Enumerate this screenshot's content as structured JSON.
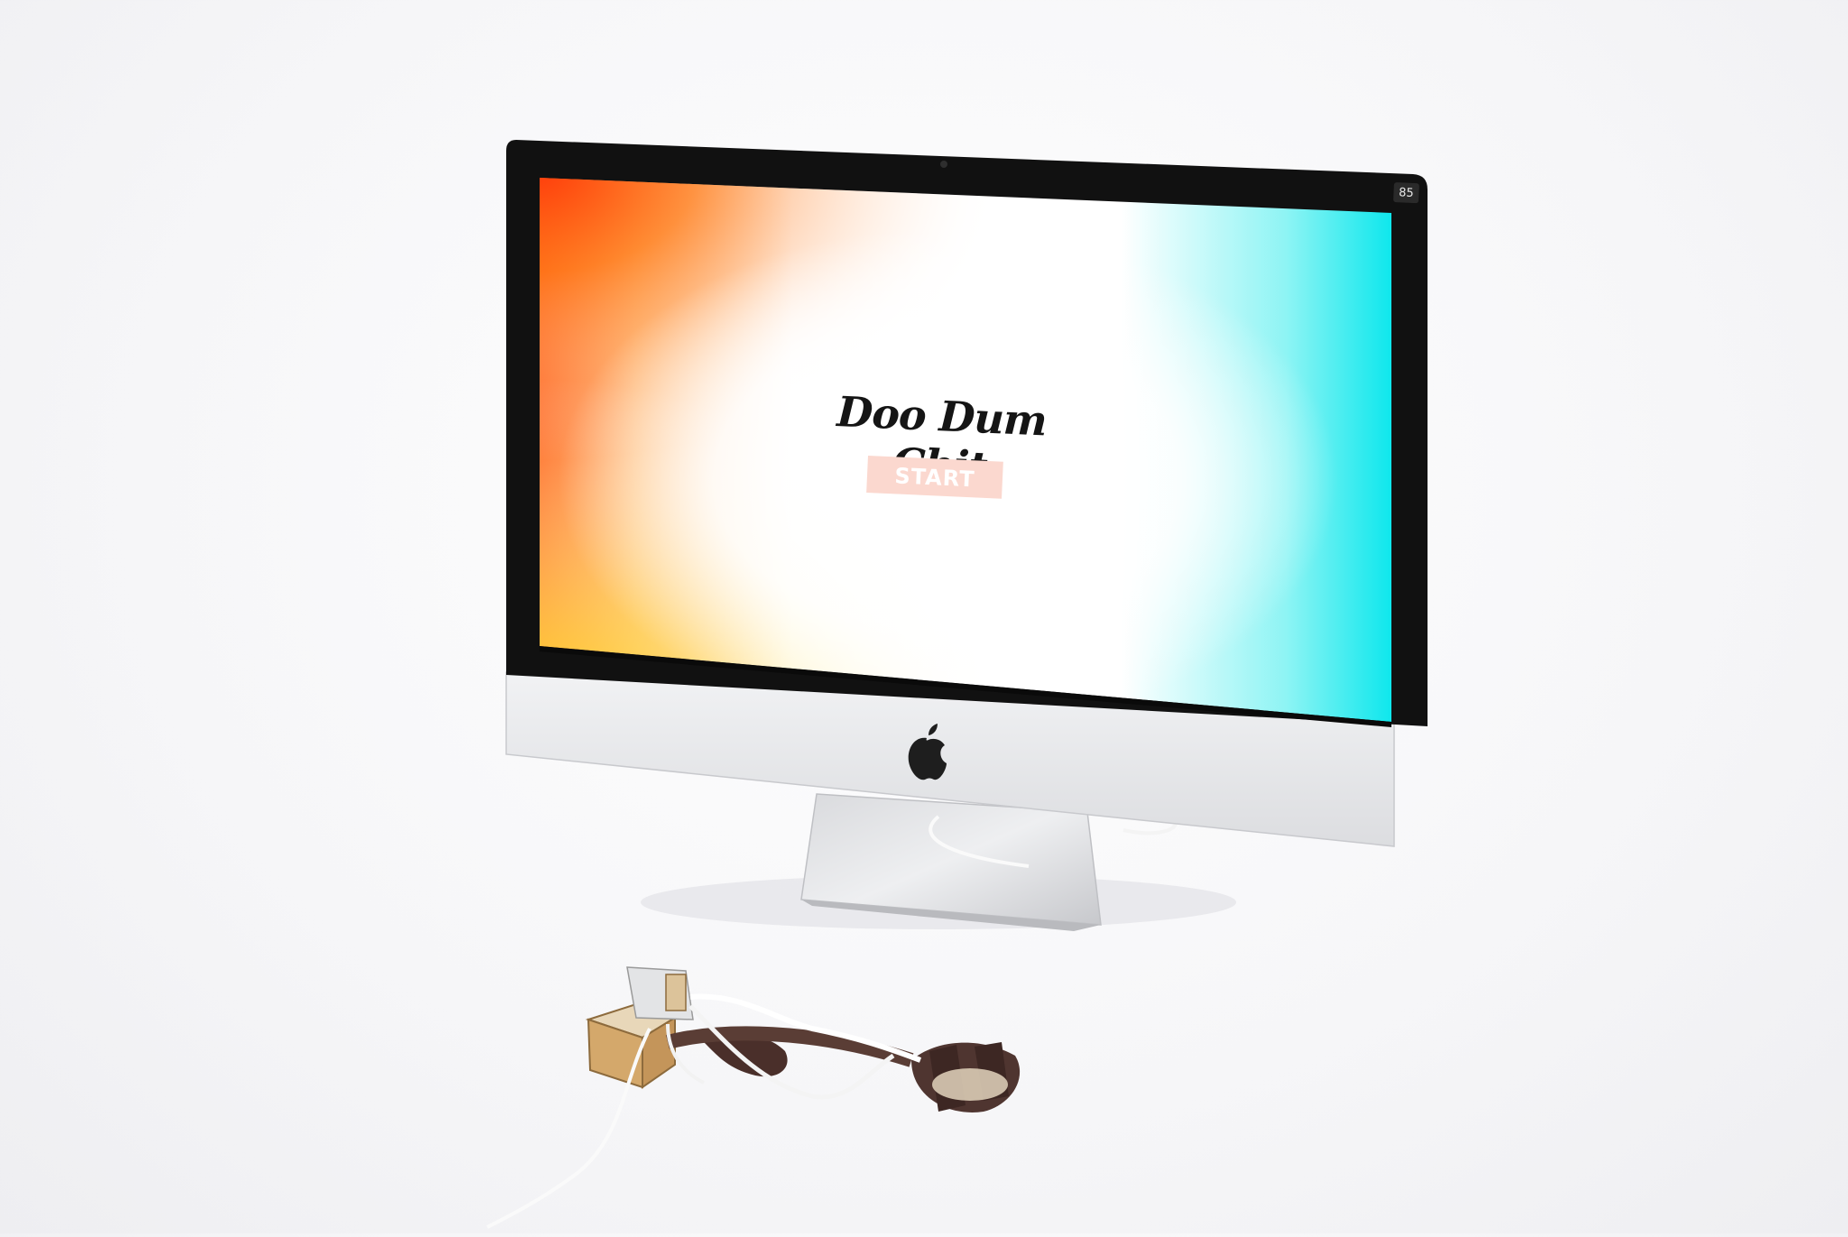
{
  "game": {
    "title": "Doo Dum Chit",
    "start_label": "START",
    "fps": "85"
  },
  "colors": {
    "screen_left": "#ff4a12",
    "screen_left_bottom": "#ffd21a",
    "screen_right": "#12e8ee",
    "start_button_bg": "#fbd8cf",
    "bezel": "#111111",
    "aluminum": "#e5e6e9"
  },
  "icons": {
    "logo": "apple-logo-icon",
    "camera": "webcam-icon"
  }
}
